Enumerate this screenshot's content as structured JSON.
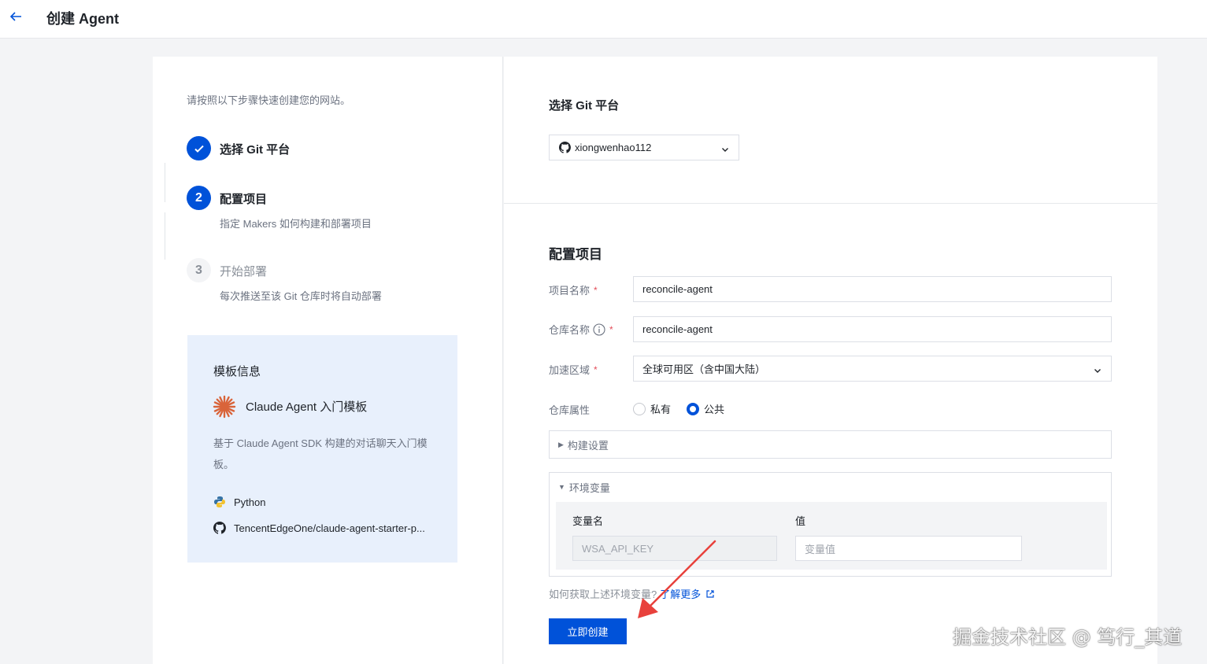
{
  "header": {
    "title": "创建 Agent",
    "back_icon": "arrow-left-icon"
  },
  "intro": "请按照以下步骤快速创建您的网站。",
  "steps": [
    {
      "number": "",
      "title": "选择 Git 平台",
      "desc": "",
      "status": "done"
    },
    {
      "number": "2",
      "title": "配置项目",
      "desc": "指定 Makers 如何构建和部署项目",
      "status": "active"
    },
    {
      "number": "3",
      "title": "开始部署",
      "desc": "每次推送至该 Git 仓库时将自动部署",
      "status": "todo"
    }
  ],
  "template": {
    "heading": "模板信息",
    "name": "Claude Agent 入门模板",
    "description": "基于 Claude Agent SDK 构建的对话聊天入门模板。",
    "language": "Python",
    "repo": "TencentEdgeOne/claude-agent-starter-p..."
  },
  "git_section": {
    "title": "选择 Git 平台",
    "account": "xiongwenhao112"
  },
  "config": {
    "title": "配置项目",
    "project_name_label": "项目名称",
    "project_name_value": "reconcile-agent",
    "repo_name_label": "仓库名称",
    "repo_name_value": "reconcile-agent",
    "region_label": "加速区域",
    "region_value": "全球可用区（含中国大陆）",
    "repo_attr_label": "仓库属性",
    "radio_private": "私有",
    "radio_public": "公共",
    "selected_attr": "公共",
    "required_mark": "*",
    "build_settings": "构建设置",
    "env_vars": "环境变量",
    "env_col_name": "变量名",
    "env_col_value": "值",
    "env_name_placeholder": "WSA_API_KEY",
    "env_value_placeholder": "变量值",
    "help_text": "如何获取上述环境变量?",
    "help_link": "了解更多",
    "submit": "立即创建"
  },
  "watermark": "掘金技术社区 @ 笃行_其道",
  "colors": {
    "primary": "#0052d9",
    "template_bg": "#e8f0fc",
    "required": "#e34d59",
    "annotation_arrow": "#e8413c"
  }
}
